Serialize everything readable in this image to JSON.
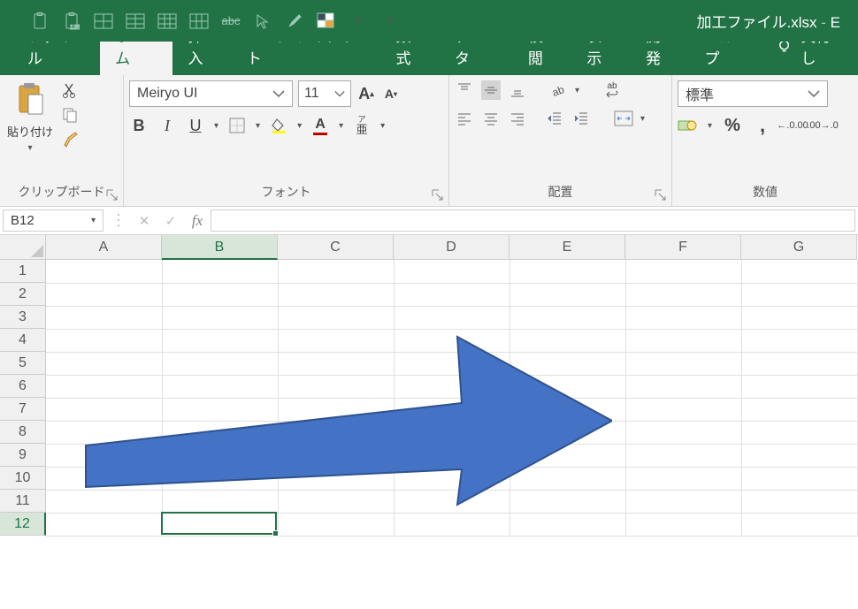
{
  "title": {
    "filename": "加工ファイル.xlsx",
    "separator": "  -  ",
    "suffix": "E"
  },
  "tabs": [
    "ファイル",
    "ホーム",
    "挿入",
    "ページ レイアウト",
    "数式",
    "データ",
    "校閲",
    "表示",
    "開発",
    "ヘルプ"
  ],
  "active_tab": 1,
  "tell_me_label": "実行し",
  "clipboard": {
    "paste_label": "貼り付け",
    "group_label": "クリップボード"
  },
  "font": {
    "name": "Meiryo UI",
    "size": "11",
    "group_label": "フォント",
    "bold": "B",
    "italic": "I",
    "underline": "U",
    "ruby": "ア亜",
    "ruby_sup": "ア"
  },
  "alignment": {
    "group_label": "配置",
    "wrap": "ab"
  },
  "number": {
    "group_label": "数値",
    "format": "標準"
  },
  "namebox": "B12",
  "formula": "",
  "columns": [
    "A",
    "B",
    "C",
    "D",
    "E",
    "F",
    "G"
  ],
  "rows": [
    "1",
    "2",
    "3",
    "4",
    "5",
    "6",
    "7",
    "8",
    "9",
    "10",
    "11",
    "12"
  ],
  "selected_col": 1,
  "selected_row": 11,
  "arrow_shape": {
    "fill": "#4472C4",
    "stroke": "#2F528F"
  }
}
